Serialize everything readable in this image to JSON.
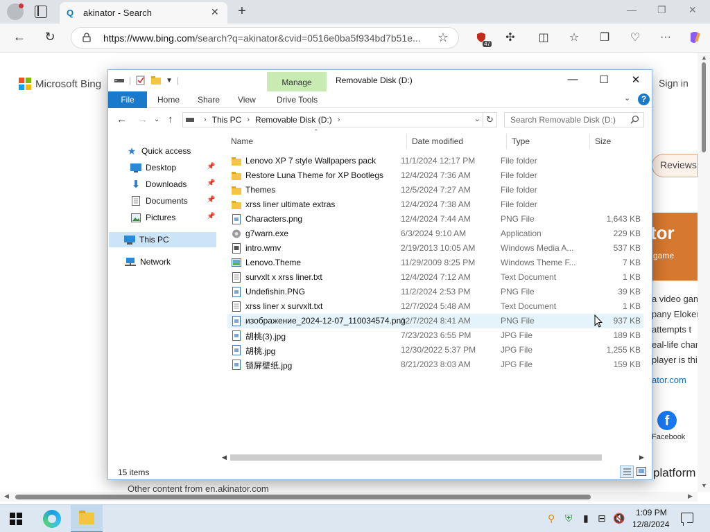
{
  "browser": {
    "tab_title": "akinator - Search",
    "tab_favicon_glyph": "Q",
    "new_tab_glyph": "+",
    "url_host": "https://www.bing.com",
    "url_rest": "/search?q=akinator&cvid=0516e0ba5f934bd7b51e...",
    "extension_badge": "47",
    "controls": {
      "minimize": "—",
      "restore": "❐",
      "close": "✕"
    }
  },
  "bing": {
    "brand": "Microsoft Bing",
    "signin": "Sign in",
    "reviews": "Reviews",
    "card_big": "tor",
    "card_small": "game",
    "snippet_lines": [
      "a video gam",
      "pany Eloker",
      "attempts t",
      "eal-life char",
      "player is thir"
    ],
    "site_link": "ator.com",
    "facebook_label": "Facebook",
    "platform_text": "platform",
    "other_content": "Other content from en.akinator.com",
    "brand_colors": [
      "#f25022",
      "#7fba00",
      "#00a4ef",
      "#ffb900"
    ]
  },
  "explorer": {
    "qat_pipe": "|",
    "manage_tab": "Manage",
    "title": "Removable Disk (D:)",
    "ribbon_tabs": {
      "file": "File",
      "home": "Home",
      "share": "Share",
      "view": "View",
      "drive_tools": "Drive Tools"
    },
    "help": "?",
    "breadcrumb": [
      "This PC",
      "Removable Disk (D:)"
    ],
    "search_placeholder": "Search Removable Disk (D:)",
    "nav": {
      "quick_access": "Quick access",
      "desktop": "Desktop",
      "downloads": "Downloads",
      "documents": "Documents",
      "pictures": "Pictures",
      "this_pc": "This PC",
      "network": "Network"
    },
    "columns": {
      "name": "Name",
      "date": "Date modified",
      "type": "Type",
      "size": "Size"
    },
    "files": [
      {
        "name": "Lenovo XP 7 style Wallpapers pack",
        "date": "11/1/2024 12:17 PM",
        "type": "File folder",
        "size": "",
        "icon": "folder-icon"
      },
      {
        "name": "Restore Luna Theme for XP Bootlegs",
        "date": "12/4/2024 7:36 AM",
        "type": "File folder",
        "size": "",
        "icon": "folder-icon"
      },
      {
        "name": "Themes",
        "date": "12/5/2024 7:27 AM",
        "type": "File folder",
        "size": "",
        "icon": "folder-icon"
      },
      {
        "name": "xrss liner ultimate extras",
        "date": "12/4/2024 7:38 AM",
        "type": "File folder",
        "size": "",
        "icon": "folder-icon"
      },
      {
        "name": "Characters.png",
        "date": "12/4/2024 7:44 AM",
        "type": "PNG File",
        "size": "1,643 KB",
        "icon": "image-file-icon"
      },
      {
        "name": "g7warn.exe",
        "date": "6/3/2024 9:10 AM",
        "type": "Application",
        "size": "229 KB",
        "icon": "exe-file-icon"
      },
      {
        "name": "intro.wmv",
        "date": "2/19/2013 10:05 AM",
        "type": "Windows Media A...",
        "size": "537 KB",
        "icon": "video-file-icon"
      },
      {
        "name": "Lenovo.Theme",
        "date": "11/29/2009 8:25 PM",
        "type": "Windows Theme F...",
        "size": "7 KB",
        "icon": "theme-file-icon"
      },
      {
        "name": "survxlt x xrss liner.txt",
        "date": "12/4/2024 7:12 AM",
        "type": "Text Document",
        "size": "1 KB",
        "icon": "text-file-icon"
      },
      {
        "name": "Undefishin.PNG",
        "date": "11/2/2024 2:53 PM",
        "type": "PNG File",
        "size": "39 KB",
        "icon": "image-file-icon"
      },
      {
        "name": "xrss liner x survxlt.txt",
        "date": "12/7/2024 5:48 AM",
        "type": "Text Document",
        "size": "1 KB",
        "icon": "text-file-icon"
      },
      {
        "name": "изображение_2024-12-07_110034574.png",
        "date": "12/7/2024 8:41 AM",
        "type": "PNG File",
        "size": "937 KB",
        "icon": "image-file-icon"
      },
      {
        "name": "胡桃(3).jpg",
        "date": "7/23/2023 6:55 PM",
        "type": "JPG File",
        "size": "189 KB",
        "icon": "image-file-icon"
      },
      {
        "name": "胡桃.jpg",
        "date": "12/30/2022 5:37 PM",
        "type": "JPG File",
        "size": "1,255 KB",
        "icon": "image-file-icon"
      },
      {
        "name": "锁屏壁纸.jpg",
        "date": "8/21/2023 8:03 AM",
        "type": "JPG File",
        "size": "159 KB",
        "icon": "image-file-icon"
      }
    ],
    "hovered_row_index": 11,
    "status": "15 items"
  },
  "taskbar": {
    "time": "1:09 PM",
    "date": "12/8/2024"
  }
}
